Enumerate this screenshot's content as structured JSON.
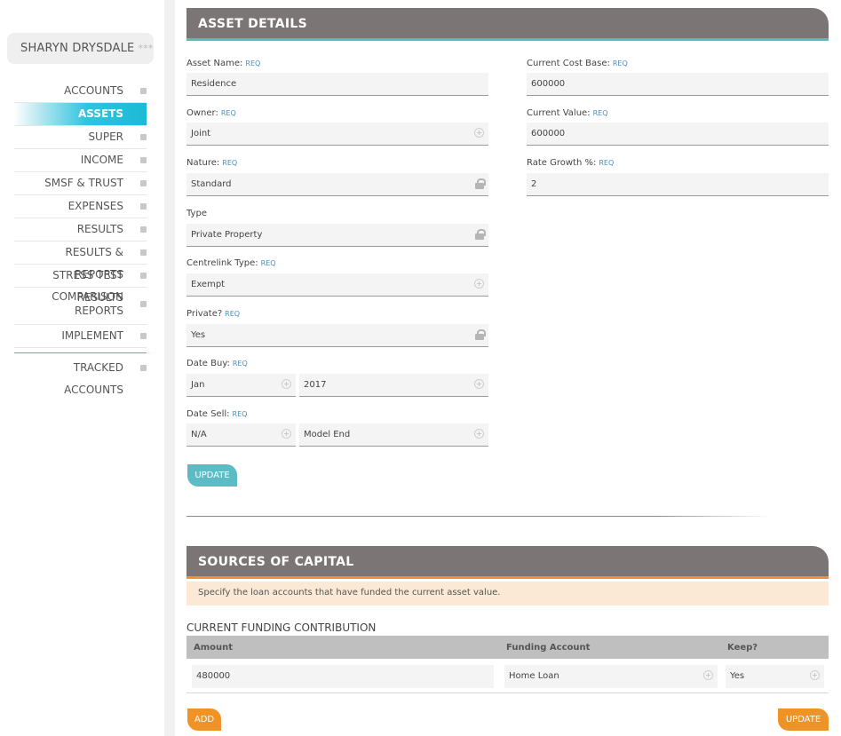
{
  "client": {
    "name": "SHARYN DRYSDALE",
    "stars": "***"
  },
  "nav": {
    "accounts": "ACCOUNTS",
    "assets": "ASSETS",
    "super": "SUPER",
    "income": "INCOME",
    "smsf": "SMSF & TRUST",
    "expenses": "EXPENSES",
    "results": "RESULTS",
    "results_reports": "RESULTS & REPORTS",
    "stress": "STRESS TEST RESULTS",
    "comparison_1": "COMPARISON",
    "comparison_2": "REPORTS",
    "implement": "IMPLEMENT",
    "tracked": "TRACKED ACCOUNTS"
  },
  "asset_details": {
    "title": "ASSET DETAILS",
    "req": "REQ",
    "asset_name": {
      "label": "Asset Name:",
      "value": "Residence"
    },
    "owner": {
      "label": "Owner:",
      "value": "Joint"
    },
    "nature": {
      "label": "Nature:",
      "value": "Standard"
    },
    "type": {
      "label": "Type",
      "value": "Private Property"
    },
    "centrelink": {
      "label": "Centrelink Type:",
      "value": "Exempt"
    },
    "private": {
      "label": "Private?",
      "value": "Yes"
    },
    "date_buy": {
      "label": "Date Buy:",
      "month": "Jan",
      "year": "2017"
    },
    "date_sell": {
      "label": "Date Sell:",
      "month": "N/A",
      "year": "Model End"
    },
    "cost_base": {
      "label": "Current Cost Base:",
      "value": "600000"
    },
    "current_value": {
      "label": "Current Value:",
      "value": "600000"
    },
    "rate_growth": {
      "label": "Rate Growth %:",
      "value": "2"
    },
    "update_label": "UPDATE"
  },
  "sources": {
    "title": "SOURCES OF CAPITAL",
    "notice": "Specify the loan accounts that have funded the current asset value.",
    "section_title": "CURRENT FUNDING CONTRIBUTION",
    "columns": [
      "Amount",
      "Funding Account",
      "Keep?"
    ],
    "rows": [
      {
        "amount": "480000",
        "account": "Home Loan",
        "keep": "Yes"
      }
    ],
    "add_label": "ADD",
    "update_label": "UPDATE"
  }
}
